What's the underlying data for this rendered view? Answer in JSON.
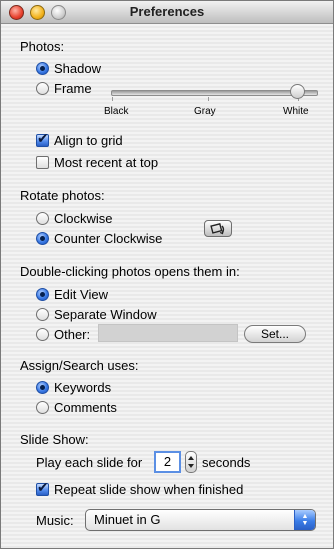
{
  "window": {
    "title": "Preferences"
  },
  "photos": {
    "heading": "Photos:",
    "shadow": "Shadow",
    "frame": "Frame",
    "slider_labels": [
      "Black",
      "Gray",
      "White"
    ],
    "slider_value": 1.0,
    "align_to_grid": "Align to grid",
    "most_recent_at_top": "Most recent at top"
  },
  "rotate": {
    "heading": "Rotate photos:",
    "clockwise": "Clockwise",
    "counter_clockwise": "Counter Clockwise"
  },
  "double_click": {
    "heading": "Double-clicking photos opens them in:",
    "edit_view": "Edit View",
    "separate_window": "Separate Window",
    "other": "Other:",
    "set_button": "Set..."
  },
  "assign_search": {
    "heading": "Assign/Search uses:",
    "keywords": "Keywords",
    "comments": "Comments"
  },
  "slideshow": {
    "heading": "Slide Show:",
    "play_each_prefix": "Play each slide for",
    "seconds_value": "2",
    "seconds_suffix": "seconds",
    "repeat": "Repeat slide show when finished",
    "music_label": "Music:",
    "music_value": "Minuet in G"
  }
}
